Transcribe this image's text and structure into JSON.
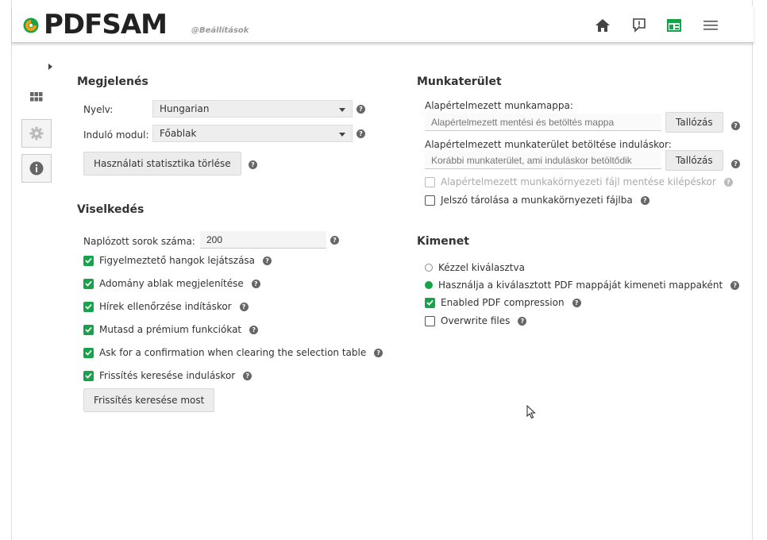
{
  "app": {
    "logo_main": "PDFSAM",
    "logo_sub": "@Beállítások",
    "accent_color": "#16a34a"
  },
  "header": {
    "icons": [
      "home-icon",
      "feedback-icon",
      "news-icon",
      "menu-icon"
    ]
  },
  "sidebar": {
    "items": [
      "expand-arrow-icon",
      "modules-grid-icon",
      "settings-gear-icon",
      "info-icon"
    ]
  },
  "appearance": {
    "title": "Megjelenés",
    "language_label": "Nyelv:",
    "language_value": "Hungarian",
    "startup_module_label": "Induló modul:",
    "startup_module_value": "Főablak",
    "clear_stats_button": "Használati statisztika törlése"
  },
  "behavior": {
    "title": "Viselkedés",
    "log_rows_label": "Naplózott sorok száma:",
    "log_rows_value": "200",
    "options": [
      {
        "label": "Figyelmeztető hangok lejátszása",
        "checked": true
      },
      {
        "label": "Adomány ablak megjelenítése",
        "checked": true
      },
      {
        "label": "Hírek ellenőrzése indításkor",
        "checked": true
      },
      {
        "label": "Mutasd a prémium funkciókat",
        "checked": true
      },
      {
        "label": "Ask for a confirmation when clearing the selection table",
        "checked": true
      },
      {
        "label": "Frissítés keresése induláskor",
        "checked": true
      }
    ],
    "check_updates_button": "Frissítés keresése most"
  },
  "workspace": {
    "title": "Munkaterület",
    "default_dir_label": "Alapértelmezett munkamappa:",
    "default_dir_placeholder": "Alapértelmezett mentési és betöltés mappa",
    "browse_button": "Tallózás",
    "load_on_start_label": "Alapértelmezett munkaterület betöltése induláskor:",
    "load_on_start_placeholder": "Korábbi munkaterület, ami induláskor betöltődik",
    "save_on_exit_label": "Alapértelmezett munkakörnyezeti fájl mentése kilépéskor",
    "save_on_exit_checked": false,
    "save_on_exit_disabled": true,
    "store_password_label": "Jelszó tárolása a munkakörnyezeti fájlba",
    "store_password_checked": false
  },
  "output": {
    "title": "Kimenet",
    "manual_label": "Kézzel kiválasztva",
    "manual_selected": false,
    "use_pdf_dir_label": "Használja a kiválasztott PDF mappáját kimeneti mappaként",
    "use_pdf_dir_selected": true,
    "compression_label": "Enabled PDF compression",
    "compression_checked": true,
    "overwrite_label": "Overwrite files",
    "overwrite_checked": false
  },
  "help_glyph": "?"
}
